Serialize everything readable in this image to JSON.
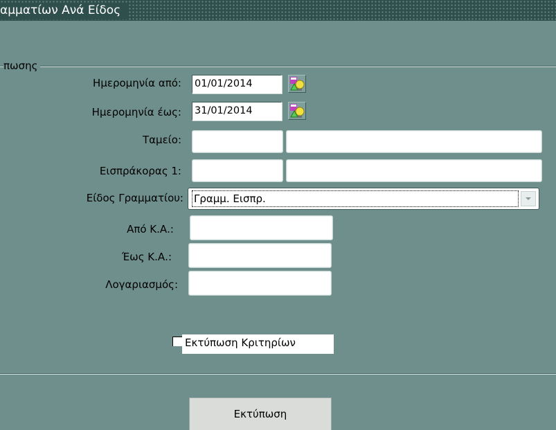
{
  "window": {
    "title": "αμματίων Ανά Είδος"
  },
  "group": {
    "label": "πωσης"
  },
  "form": {
    "date_from": {
      "label": "Ημερομηνία από:",
      "value": "01/01/2014"
    },
    "date_to": {
      "label": "Ημερομηνία έως:",
      "value": "31/01/2014"
    },
    "cashbox": {
      "label": "Ταμείο:",
      "code": "",
      "name": ""
    },
    "collector": {
      "label": "Εισπράκορας 1:",
      "code": "",
      "name": ""
    },
    "doc_type": {
      "label": "Είδος Γραμματίου:",
      "value": "Γραμμ. Εισπρ."
    },
    "from_account": {
      "label": "Από Κ.Α.:",
      "value": ""
    },
    "to_account": {
      "label": "Έως Κ.Α.:",
      "value": ""
    },
    "account": {
      "label": "Λογαριασμός:",
      "value": ""
    },
    "print_criteria": {
      "label": "Εκτύπωση Κριτηρίων",
      "checked": false
    }
  },
  "buttons": {
    "print_label": "Εκτύπωση"
  },
  "icons": {
    "calendar": "calendar-lookup-icon",
    "dropdown": "chevron-down-icon"
  },
  "colors": {
    "background": "#6f8f8c",
    "titlebar": "#2f4f4d"
  }
}
